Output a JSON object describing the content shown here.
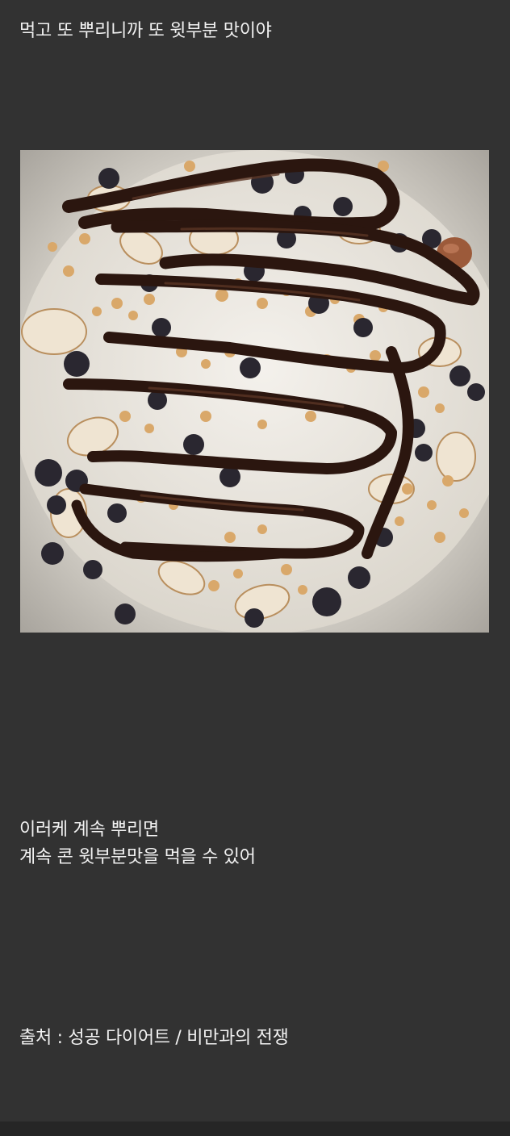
{
  "post": {
    "line_1": "먹고 또 뿌리니까 또 윗부분 맛이야",
    "line_2": "이러케 계속 뿌리면",
    "line_3": "계속 콘 윗부분맛을 먹을 수 있어",
    "source": "출처 : 성공 다이어트 / 비만과의 전쟁"
  },
  "colors": {
    "background": "#323232",
    "text": "#f2f2f2"
  }
}
